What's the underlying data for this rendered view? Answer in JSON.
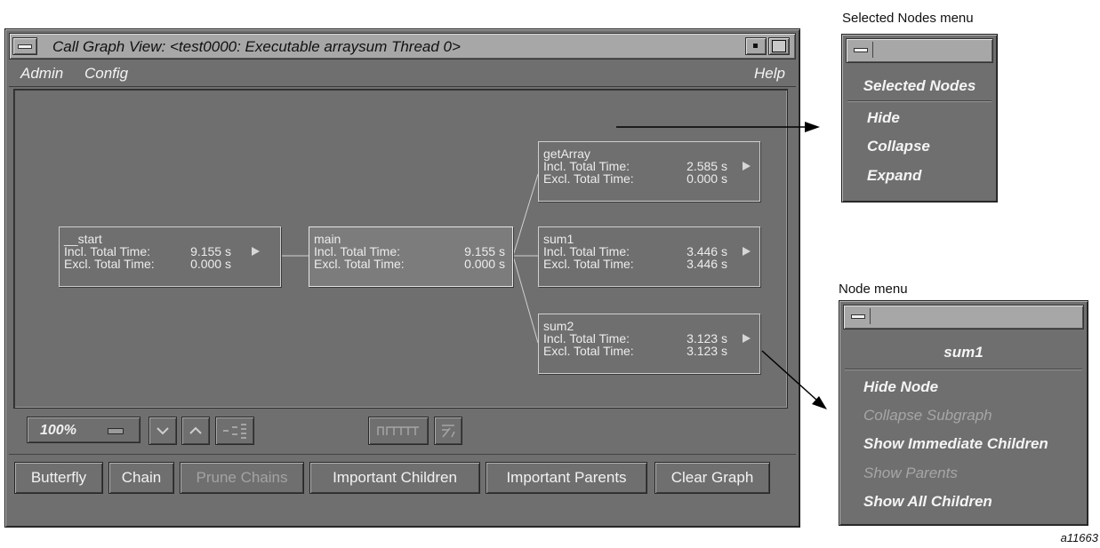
{
  "window": {
    "title": "Call Graph View: <test0000: Executable arraysum Thread 0>",
    "menus": [
      "Admin",
      "Config",
      "Help"
    ]
  },
  "nodes": [
    {
      "name": "__start",
      "incl_label": "Incl. Total Time:",
      "incl": "9.155 s",
      "excl_label": "Excl. Total Time:",
      "excl": "0.000 s"
    },
    {
      "name": "main",
      "incl_label": "Incl. Total Time:",
      "incl": "9.155 s",
      "excl_label": "Excl. Total Time:",
      "excl": "0.000 s"
    },
    {
      "name": "getArray",
      "incl_label": "Incl. Total Time:",
      "incl": "2.585 s",
      "excl_label": "Excl. Total Time:",
      "excl": "0.000 s"
    },
    {
      "name": "sum1",
      "incl_label": "Incl. Total Time:",
      "incl": "3.446 s",
      "excl_label": "Excl. Total Time:",
      "excl": "3.446 s"
    },
    {
      "name": "sum2",
      "incl_label": "Incl. Total Time:",
      "incl": "3.123 s",
      "excl_label": "Excl. Total Time:",
      "excl": "3.123 s"
    }
  ],
  "toolbar": {
    "zoom": "100%"
  },
  "buttons": [
    "Butterfly",
    "Chain",
    "Prune Chains",
    "Important Children",
    "Important Parents",
    "Clear Graph"
  ],
  "selected_menu": {
    "caption": "Selected Nodes menu",
    "header": "Selected Nodes",
    "items": [
      "Hide",
      "Collapse",
      "Expand"
    ]
  },
  "node_menu": {
    "caption": "Node menu",
    "header": "sum1",
    "items": [
      "Hide Node",
      "Collapse Subgraph",
      "Show Immediate Children",
      "Show Parents",
      "Show All Children"
    ]
  },
  "figure_id": "a11663",
  "colors": {
    "window_bg": "#6f6f6f",
    "titlebar": "#a7a7a7",
    "text": "#f4f4f4",
    "disabled": "#a3a3a3"
  }
}
